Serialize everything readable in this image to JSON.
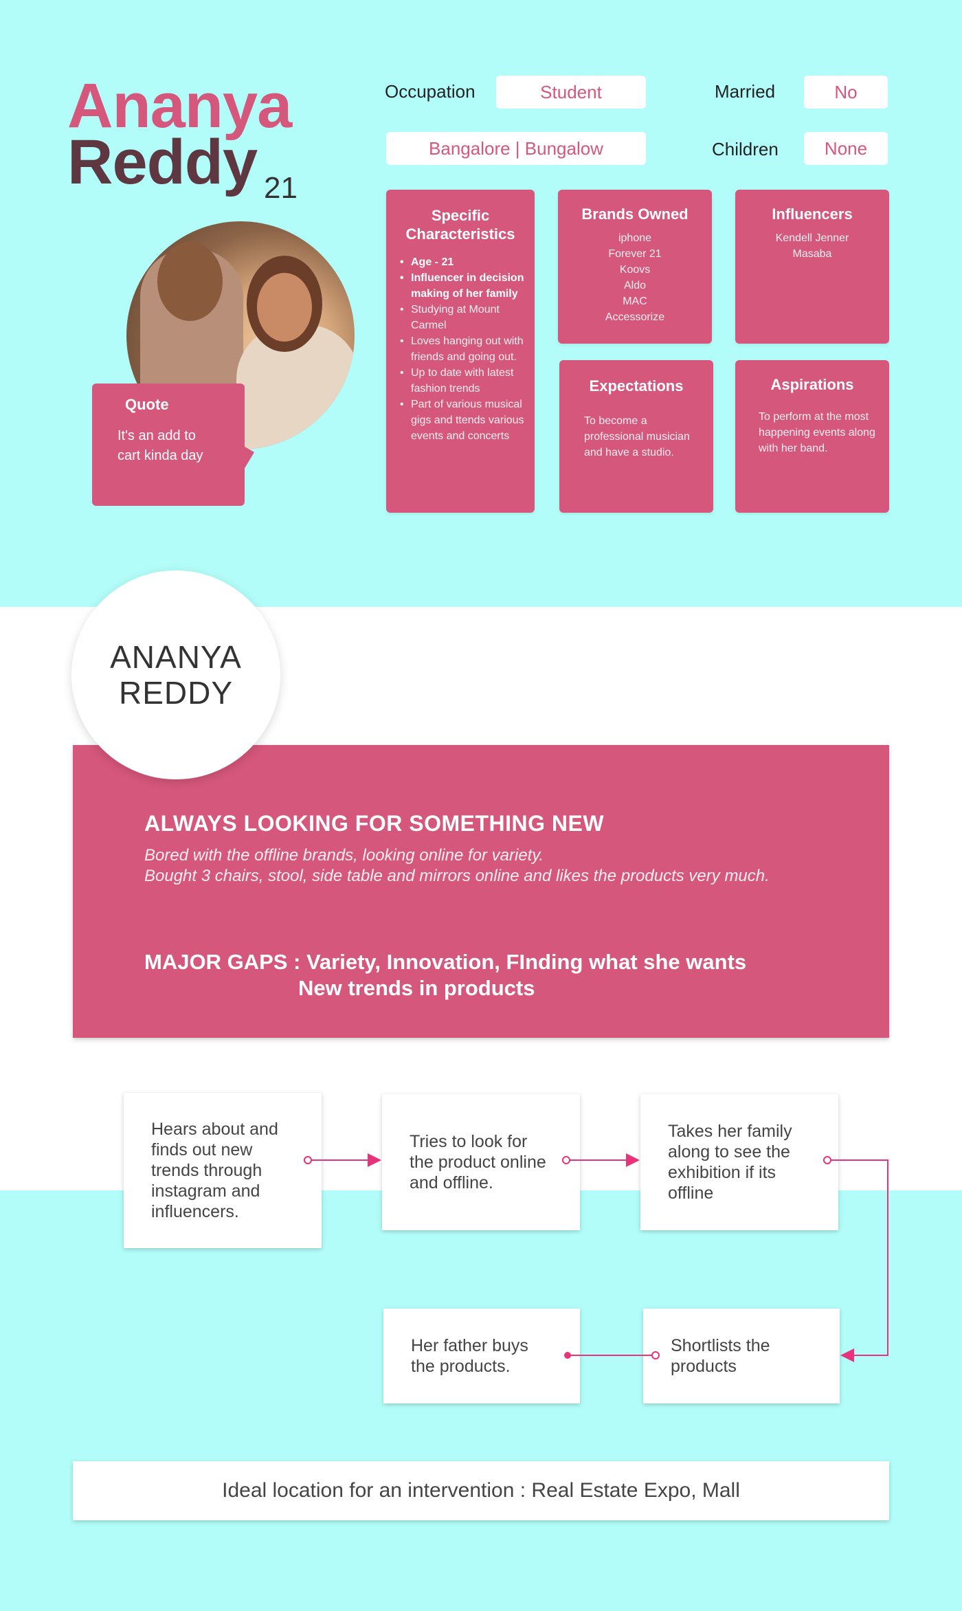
{
  "persona": {
    "first_name": "Ananya",
    "last_name": "Reddy",
    "age": "21"
  },
  "quote": {
    "title": "Quote",
    "text": "It's an add to cart kinda day"
  },
  "fields": {
    "occupation_label": "Occupation",
    "occupation_value": "Student",
    "married_label": "Married",
    "married_value": "No",
    "location_value": "Bangalore | Bungalow",
    "children_label": "Children",
    "children_value": "None"
  },
  "cards": {
    "characteristics": {
      "title_line1": "Specific",
      "title_line2": "Characteristics",
      "items": [
        "Age - 21",
        "Influencer in decision making of her family",
        "Studying at Mount Carmel",
        "Loves hanging out with friends and going out.",
        "Up to date with latest fashion trends",
        "Part of various musical gigs and ttends various events and concerts"
      ]
    },
    "brands": {
      "title": "Brands Owned",
      "items": [
        "iphone",
        "Forever 21",
        "Koovs",
        "Aldo",
        "MAC",
        "Accessorize"
      ]
    },
    "influencers": {
      "title": "Influencers",
      "items": [
        "Kendell Jenner",
        "Masaba"
      ]
    },
    "expectations": {
      "title": "Expectations",
      "text": "To become a professional musician and have a studio."
    },
    "aspirations": {
      "title": "Aspirations",
      "text": "To perform at the most happening events along with her band."
    }
  },
  "name_badge": {
    "line1": "ANANYA",
    "line2": "REDDY"
  },
  "insight": {
    "heading": "ALWAYS LOOKING FOR SOMETHING NEW",
    "line1": "Bored with the offline brands, looking online for variety.",
    "line2": "Bought 3 chairs, stool, side table and mirrors online and likes the products very much.",
    "gaps_line1": "MAJOR GAPS : Variety, Innovation, FInding what she wants",
    "gaps_line2": "New trends in products"
  },
  "journey": [
    "Hears about and finds out new trends through instagram and influencers.",
    "Tries to look for the product online and offline.",
    "Takes her family along to see the exhibition if its offline",
    "Shortlists the products",
    "Her father buys the products."
  ],
  "intervention": "Ideal location for an intervention : Real Estate Expo, Mall",
  "colors": {
    "accent": "#d6577c",
    "name_dark": "#5e3740",
    "background": "#b2fdf9",
    "connector": "#e8337a"
  }
}
